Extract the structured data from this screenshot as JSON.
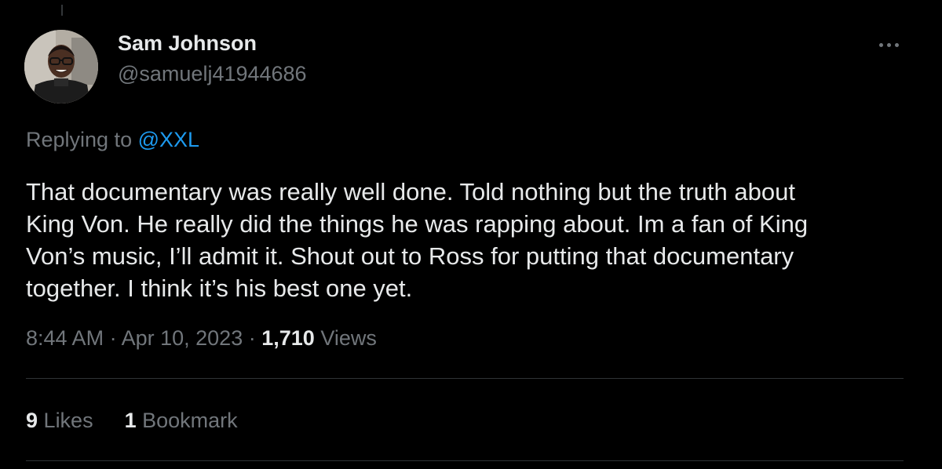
{
  "author": {
    "name": "Sam Johnson",
    "handle": "@samuelj41944686"
  },
  "reply": {
    "prefix": "Replying to",
    "to": "@XXL"
  },
  "tweet": {
    "lines": [
      "That documentary was really well done. Told nothing but the truth about",
      "King Von. He really did the things he was rapping about. Im a fan of King",
      "Von’s music, I’ll admit it. Shout out to Ross for putting that documentary",
      "together. I think it’s his best one yet."
    ]
  },
  "meta": {
    "time": "8:44 AM",
    "separator": "·",
    "date": "Apr 10, 2023",
    "views_count": "1,710",
    "views_label": "Views"
  },
  "stats": {
    "likes_count": "9",
    "likes_label": "Likes",
    "bookmarks_count": "1",
    "bookmarks_label": "Bookmark"
  },
  "colors": {
    "background": "#000000",
    "text_primary": "#e7e9ea",
    "text_secondary": "#71767b",
    "link": "#1d9bf0",
    "divider": "#2f3336"
  },
  "icons": {
    "more": "more-horizontal-icon"
  }
}
